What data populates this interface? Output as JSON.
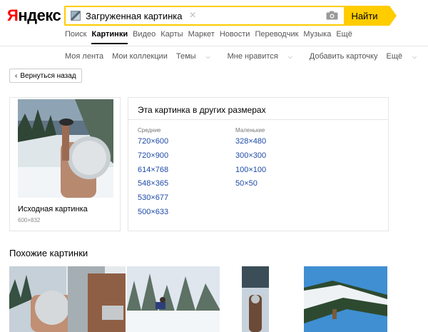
{
  "header": {
    "logo_first": "Я",
    "logo_rest": "ндекс",
    "search_query": "Загруженная картинка",
    "find_label": "Найти"
  },
  "nav": {
    "items": [
      "Поиск",
      "Картинки",
      "Видео",
      "Карты",
      "Маркет",
      "Новости",
      "Переводчик",
      "Музыка",
      "Ещё"
    ],
    "active": "Картинки"
  },
  "subnav": {
    "items": [
      "Моя лента",
      "Мои коллекции",
      "Темы",
      "Мне нравится",
      "Добавить карточку",
      "Ещё"
    ]
  },
  "back_label": "Вернуться назад",
  "original": {
    "title": "Исходная картинка",
    "size": "600×832"
  },
  "sizes": {
    "title": "Эта картинка в других размерах",
    "medium_label": "Средние",
    "small_label": "Маленькие",
    "medium": [
      "720×600",
      "720×900",
      "614×768",
      "548×365",
      "530×677",
      "500×633"
    ],
    "small": [
      "328×480",
      "300×300",
      "100×100",
      "50×50"
    ]
  },
  "similar_title": "Похожие картинки",
  "colors": {
    "accent_yellow": "#ffcc00",
    "link_blue": "#1d4aa8",
    "logo_red": "#ff0000"
  }
}
